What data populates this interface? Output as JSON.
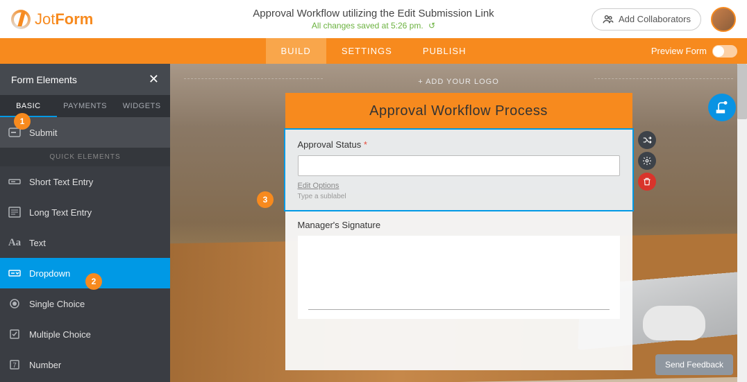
{
  "logo": {
    "text_light": "Jot",
    "text_bold": "Form"
  },
  "header": {
    "title": "Approval Workflow utilizing the Edit Submission Link",
    "saved_text": "All changes saved at 5:26 pm.",
    "collab_label": "Add Collaborators"
  },
  "nav": {
    "tabs": [
      "BUILD",
      "SETTINGS",
      "PUBLISH"
    ],
    "build": "BUILD",
    "settings": "SETTINGS",
    "publish": "PUBLISH",
    "preview_label": "Preview Form"
  },
  "sidebar": {
    "title": "Form Elements",
    "tabs": {
      "basic": "BASIC",
      "payments": "PAYMENTS",
      "widgets": "WIDGETS"
    },
    "quick_header": "QUICK ELEMENTS",
    "items": {
      "submit": "Submit",
      "short_text": "Short Text Entry",
      "long_text": "Long Text Entry",
      "text": "Text",
      "dropdown": "Dropdown",
      "single_choice": "Single Choice",
      "multiple_choice": "Multiple Choice",
      "number": "Number"
    }
  },
  "canvas": {
    "add_logo": "+ ADD YOUR LOGO",
    "form_title": "Approval Workflow Process",
    "approval_field": {
      "label": "Approval Status",
      "edit_options": "Edit Options",
      "sublabel_placeholder": "Type a sublabel"
    },
    "signature_field": {
      "label": "Manager's Signature"
    }
  },
  "callouts": {
    "c1": "1",
    "c2": "2",
    "c3": "3"
  },
  "misc": {
    "feedback": "Send Feedback"
  },
  "colors": {
    "accent": "#f78a1e",
    "blue": "#0099e5"
  }
}
